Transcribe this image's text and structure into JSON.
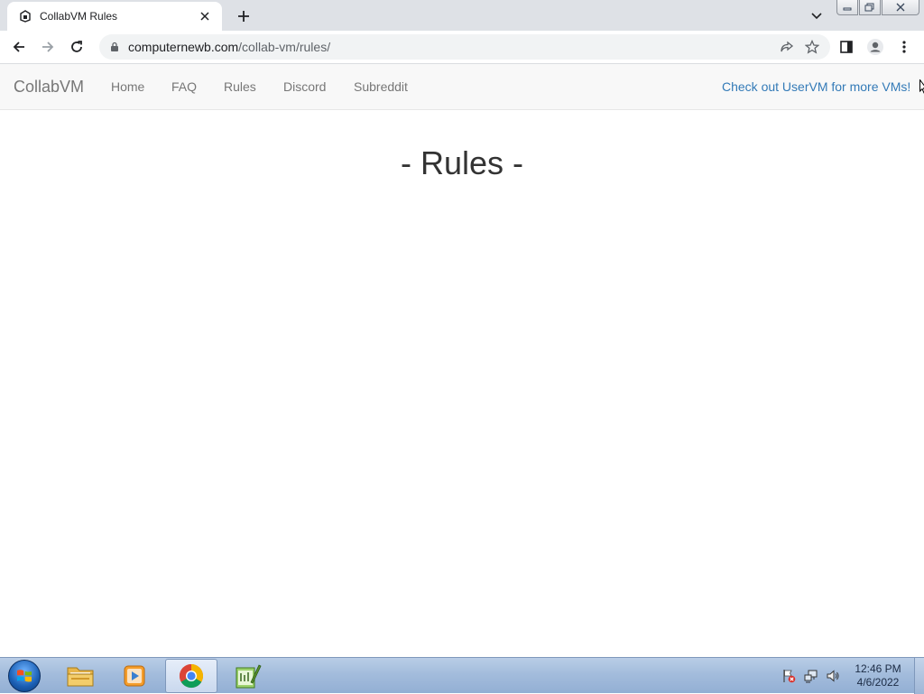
{
  "browser": {
    "tab_title": "CollabVM Rules",
    "url_host": "computernewb.com",
    "url_path": "/collab-vm/rules/"
  },
  "site": {
    "brand": "CollabVM",
    "nav": [
      "Home",
      "FAQ",
      "Rules",
      "Discord",
      "Subreddit"
    ],
    "nav_right": "Check out UserVM for more VMs!"
  },
  "page": {
    "heading": "- Rules -"
  },
  "taskbar": {
    "clock_time": "12:46 PM",
    "clock_date": "4/6/2022"
  },
  "colors": {
    "tabstrip": "#dee1e6",
    "navbar_bg": "#f8f8f8",
    "nav_text": "#777777",
    "link": "#337ab7",
    "heading": "#333333",
    "taskbar": "#a3bcdc"
  }
}
